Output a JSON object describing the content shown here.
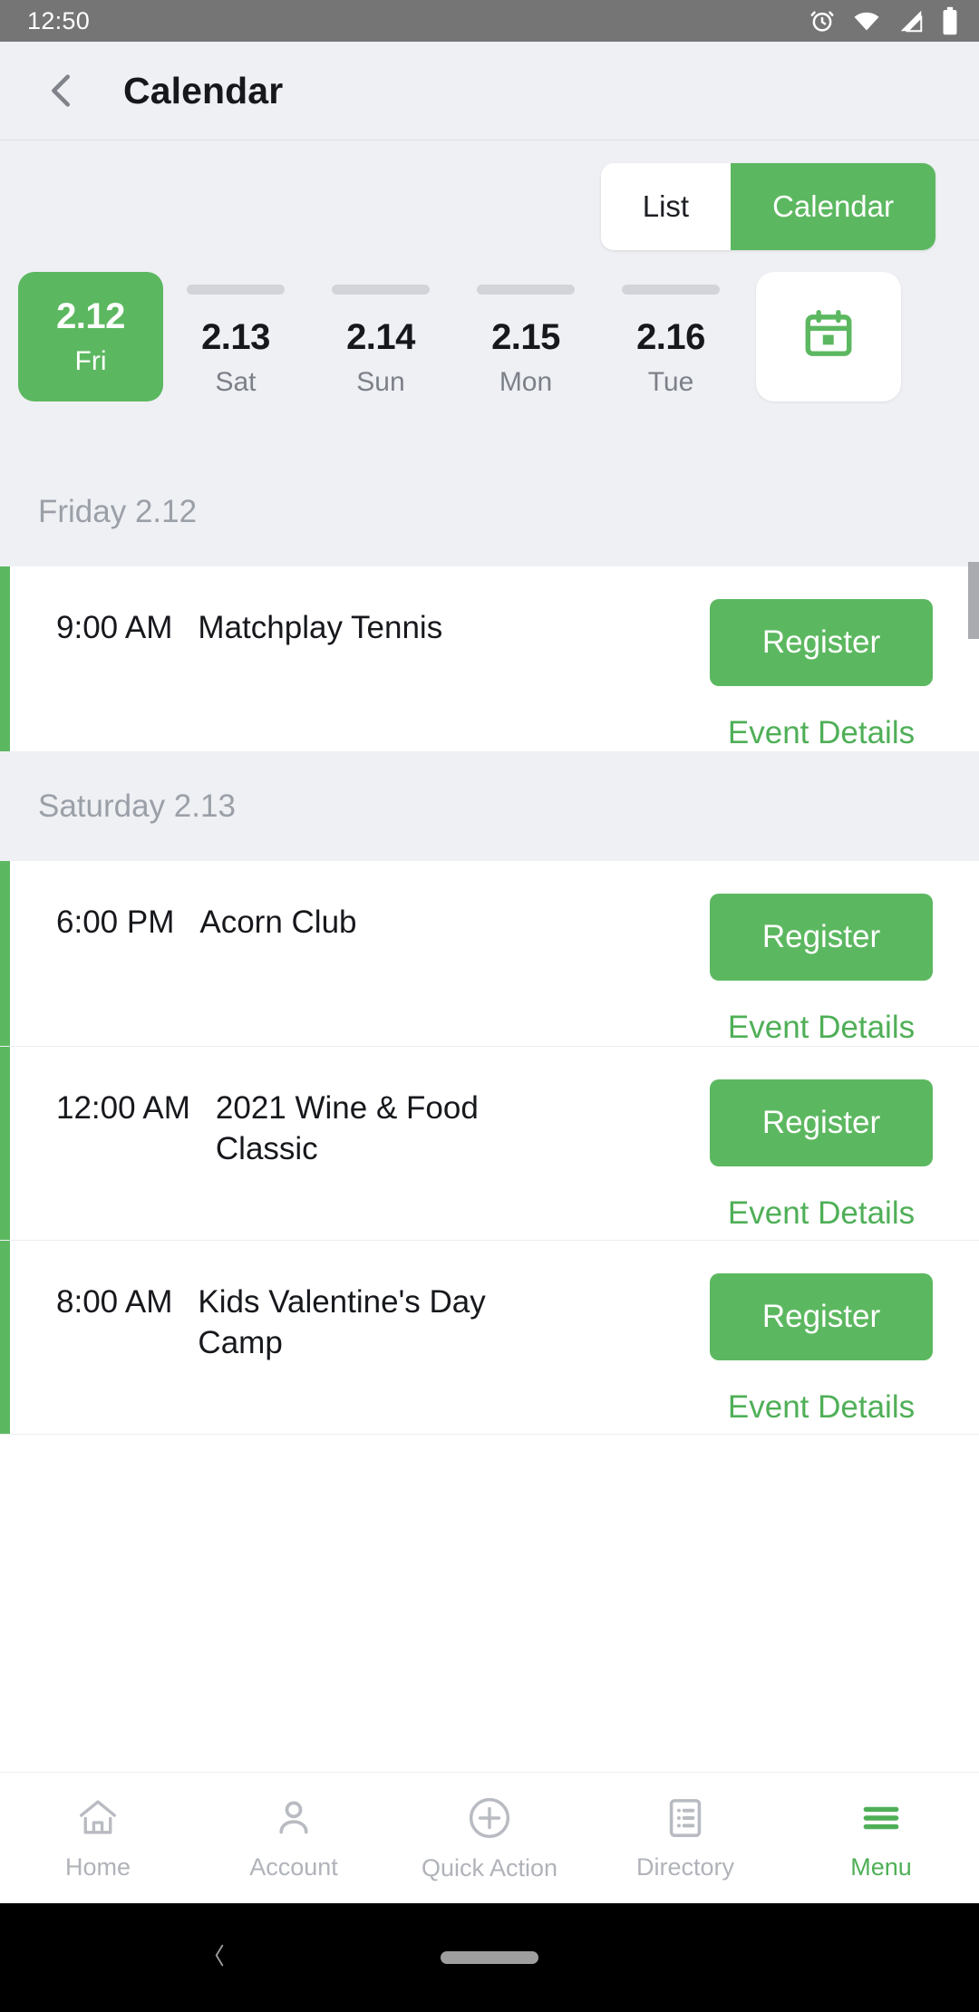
{
  "status_bar": {
    "time": "12:50",
    "icons": [
      "alarm-icon",
      "wifi-icon",
      "signal-icon",
      "battery-icon"
    ]
  },
  "header": {
    "back_icon": "chevron-left-icon",
    "title": "Calendar"
  },
  "view_toggle": {
    "options": [
      {
        "label": "List",
        "active": false
      },
      {
        "label": "Calendar",
        "active": true
      }
    ],
    "active_color": "#5cb860"
  },
  "date_strip": {
    "dates": [
      {
        "num": "2.12",
        "day": "Fri",
        "selected": true
      },
      {
        "num": "2.13",
        "day": "Sat",
        "selected": false
      },
      {
        "num": "2.14",
        "day": "Sun",
        "selected": false
      },
      {
        "num": "2.15",
        "day": "Mon",
        "selected": false
      },
      {
        "num": "2.16",
        "day": "Tue",
        "selected": false
      }
    ],
    "picker_icon": "calendar-icon"
  },
  "sections": [
    {
      "header": "Friday 2.12",
      "events": [
        {
          "time": "9:00 AM",
          "title": "Matchplay Tennis",
          "register_label": "Register",
          "details_label": "Event Details"
        }
      ]
    },
    {
      "header": "Saturday 2.13",
      "events": [
        {
          "time": "6:00 PM",
          "title": "Acorn Club",
          "register_label": "Register",
          "details_label": "Event Details"
        },
        {
          "time": "12:00 AM",
          "title": "2021 Wine & Food Classic",
          "register_label": "Register",
          "details_label": "Event Details"
        },
        {
          "time": "8:00 AM",
          "title": "Kids Valentine's Day Camp",
          "register_label": "Register",
          "details_label": "Event Details"
        }
      ]
    }
  ],
  "bottom_nav": {
    "items": [
      {
        "label": "Home",
        "icon": "home-icon",
        "active": false
      },
      {
        "label": "Account",
        "icon": "person-icon",
        "active": false
      },
      {
        "label": "Quick Action",
        "icon": "plus-circle-icon",
        "active": false
      },
      {
        "label": "Directory",
        "icon": "document-list-icon",
        "active": false
      },
      {
        "label": "Menu",
        "icon": "hamburger-icon",
        "active": true
      }
    ],
    "active_color": "#4faf57",
    "inactive_color": "#b0b3b9"
  },
  "gesture_bar": {
    "back_icon": "chevron-left-icon",
    "home_pill": "home-pill"
  },
  "theme": {
    "accent": "#5cb860",
    "link": "#4faf57",
    "page_bg": "#eff0f4",
    "card_bg": "#ffffff",
    "status_bg": "#757575"
  }
}
